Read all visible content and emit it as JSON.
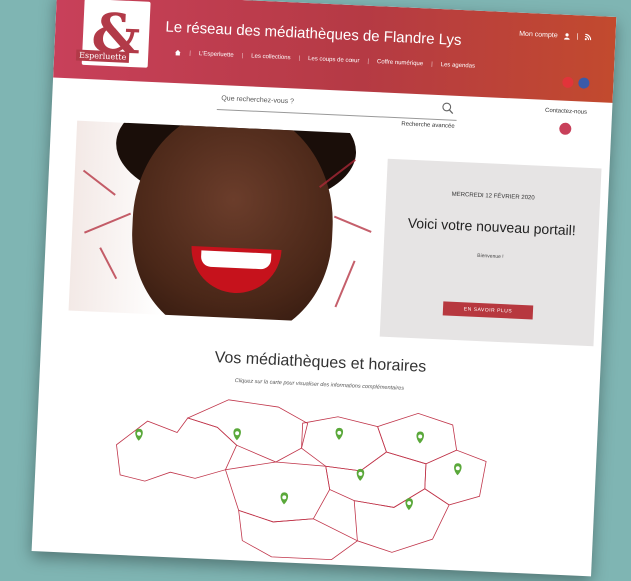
{
  "header": {
    "logo_symbol": "&",
    "logo_text": "Esperluette",
    "site_title": "Le réseau des médiathèques de Flandre Lys",
    "account_label": "Mon compte",
    "nav_items": [
      {
        "label": "L'Esperluette"
      },
      {
        "label": "Les collections"
      },
      {
        "label": "Les coups de cœur"
      },
      {
        "label": "Coffre numérique"
      },
      {
        "label": "Les agendas"
      }
    ],
    "social_colors": [
      "#e2343a",
      "#3b5aa8"
    ]
  },
  "search": {
    "placeholder": "Que recherchez-vous ?",
    "advanced_label": "Recherche avancée"
  },
  "contact": {
    "label": "Contactez-nous"
  },
  "featured": {
    "date": "MERCREDI 12 FÉVRIER 2020",
    "title": "Voici votre nouveau portail!",
    "subtitle": "Bienvenue !",
    "button_label": "EN SAVOIR PLUS"
  },
  "section": {
    "title": "Vos médiathèques et horaires",
    "subtitle": "Cliquez sur la carte pour visualiser des informations complémentaires"
  },
  "colors": {
    "accent": "#b23a48",
    "map_pin": "#5aa83a",
    "map_border": "#c0354a"
  }
}
